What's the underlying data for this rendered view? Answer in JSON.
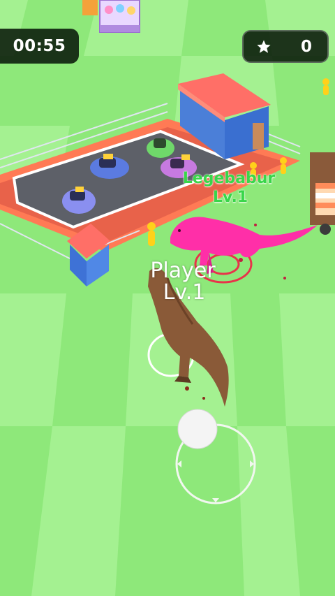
{
  "hud": {
    "timer": "00:55",
    "score": "0",
    "score_icon": "star-icon"
  },
  "characters": {
    "enemy": {
      "name": "Legebabur",
      "level": "Lv.1",
      "color": "#ff2fa8"
    },
    "player": {
      "name": "Player",
      "level": "Lv.1",
      "color": "#8a5a38"
    }
  },
  "colors": {
    "ground_light": "#a6f293",
    "ground_dark": "#8ee87a",
    "enemy_label": "#39d64a"
  }
}
